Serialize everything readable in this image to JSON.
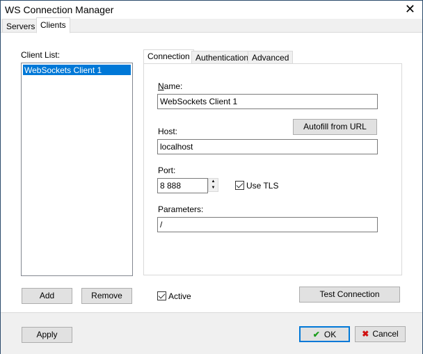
{
  "window": {
    "title": "WS Connection Manager",
    "close_icon": "close-icon"
  },
  "tabs": [
    {
      "label": "Servers"
    },
    {
      "label": "Clients"
    }
  ],
  "client_list": {
    "label": "Client List:",
    "items": [
      "WebSockets Client 1"
    ],
    "selected": "WebSockets Client 1",
    "selection_color": "#0078d7"
  },
  "inner_tabs": [
    {
      "label": "Connection"
    },
    {
      "label": "Authentication"
    },
    {
      "label": "Advanced"
    }
  ],
  "connection": {
    "name_label": "Name:",
    "name_value": "WebSockets Client 1",
    "autofill_label": "Autofill from URL",
    "host_label": "Host:",
    "host_value": "localhost",
    "port_label": "Port:",
    "port_value": "8 888",
    "use_tls_label": "Use TLS",
    "use_tls_checked": true,
    "parameters_label": "Parameters:",
    "parameters_value": "/"
  },
  "buttons": {
    "add": "Add",
    "remove": "Remove",
    "active_label": "Active",
    "active_checked": true,
    "test": "Test Connection",
    "apply": "Apply",
    "ok": "OK",
    "cancel": "Cancel"
  },
  "colors": {
    "ok_icon": "#1a9c1a",
    "cancel_icon": "#d01010",
    "default_border": "#0078d7"
  }
}
